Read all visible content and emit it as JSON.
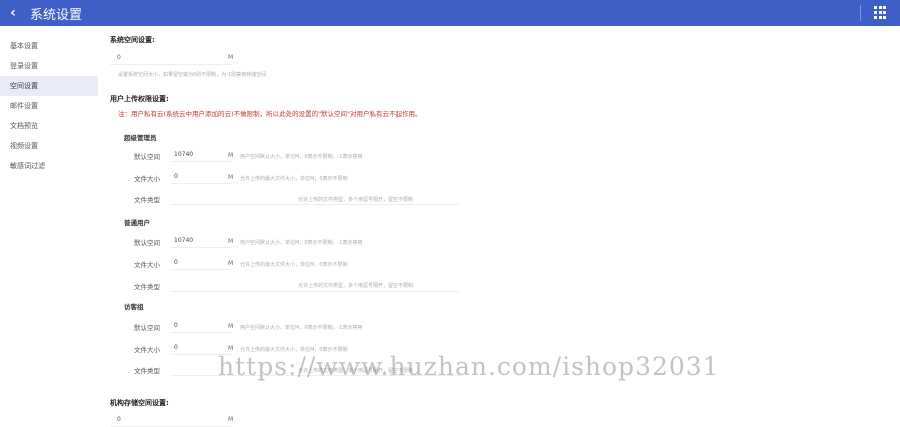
{
  "header": {
    "title": "系统设置",
    "back_icon": "chevron-left-icon",
    "apps_icon": "grid-icon",
    "color": "#3f5fc8"
  },
  "sidebar": {
    "items": [
      {
        "label": "基本设置",
        "active": false
      },
      {
        "label": "登录设置",
        "active": false
      },
      {
        "label": "空间设置",
        "active": true
      },
      {
        "label": "邮件设置",
        "active": false
      },
      {
        "label": "文档预览",
        "active": false
      },
      {
        "label": "视频设置",
        "active": false
      },
      {
        "label": "敏感词过滤",
        "active": false
      }
    ]
  },
  "main": {
    "system_space": {
      "title": "系统空间设置:",
      "value": "0",
      "unit": "M",
      "hint": "设置系统空间大小，如果留空或为0则不限制，为-1则禁用存储空间"
    },
    "user_permission": {
      "title": "用户上传权限设置:",
      "warning": "注：用户私有云(系统云中用户添加的云)不做限制，所以此处的设置的\"默认空间\"对用户私有云不起作用。",
      "groups": [
        {
          "title": "超级管理员",
          "default_space_label": "默认空间",
          "default_space_value": "10740",
          "default_space_unit": "M",
          "default_space_hint": "用户空间默认大小，单位M，0表示不限制，-1表示禁用",
          "file_size_label": "文件大小",
          "file_size_value": "0",
          "file_size_unit": "M",
          "file_size_hint": "允许上传的最大文件大小，单位M，0表示不限制",
          "file_type_label": "文件类型",
          "file_type_hint": "允许上传的文件类型，多个用逗号隔开，留空不限制"
        },
        {
          "title": "普通用户",
          "default_space_label": "默认空间",
          "default_space_value": "10740",
          "default_space_unit": "M",
          "default_space_hint": "用户空间默认大小，单位M，0表示不限制，-1表示禁用",
          "file_size_label": "文件大小",
          "file_size_value": "0",
          "file_size_unit": "M",
          "file_size_hint": "允许上传的最大文件大小，单位M，0表示不限制",
          "file_type_label": "文件类型",
          "file_type_hint": "允许上传的文件类型，多个用逗号隔开，留空不限制"
        },
        {
          "title": "访客组",
          "default_space_label": "默认空间",
          "default_space_value": "0",
          "default_space_unit": "M",
          "default_space_hint": "用户空间默认大小，单位M，0表示不限制，-1表示禁用",
          "file_size_label": "文件大小",
          "file_size_value": "0",
          "file_size_unit": "M",
          "file_size_hint": "允许上传的最大文件大小，单位M，0表示不限制",
          "file_type_label": "文件类型",
          "file_type_hint": "允许上传的文件类型，多个用逗号隔开，留空不限制"
        }
      ]
    },
    "org_space": {
      "title": "机构存储空间设置:",
      "value": "0",
      "unit": "M"
    }
  },
  "watermark": "https://www.huzhan.com/ishop32031"
}
